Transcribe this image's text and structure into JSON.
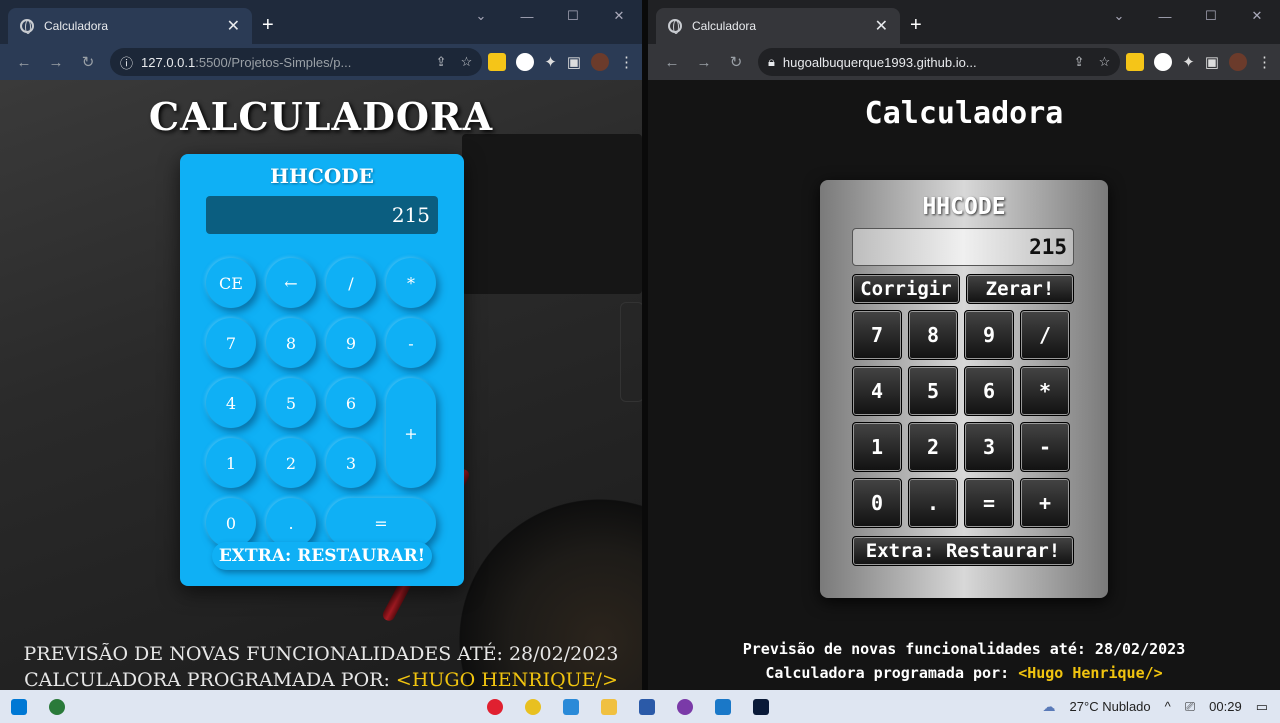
{
  "left_window": {
    "tab_title": "Calculadora",
    "url_host": "127.0.0.1",
    "url_rest": ":5500/Projetos-Simples/p...",
    "page": {
      "title": "CALCULADORA",
      "brand": "HHCODE",
      "display": "215",
      "buttons": [
        "CE",
        "←",
        "/",
        "*",
        "7",
        "8",
        "9",
        "-",
        "4",
        "5",
        "6",
        "+",
        "1",
        "2",
        "3",
        "0",
        ".",
        "="
      ],
      "extra": "EXTRA: RESTAURAR!",
      "footer_line1": "PREVISÃO DE NOVAS FUNCIONALIDADES ATÉ: 28/02/2023",
      "footer_line2_prefix": "CALCULADORA PROGRAMADA POR: ",
      "footer_line2_link": "<HUGO HENRIQUE/>"
    }
  },
  "right_window": {
    "tab_title": "Calculadora",
    "url": "hugoalbuquerque1993.github.io...",
    "page": {
      "title": "Calculadora",
      "brand": "HHCODE",
      "display": "215",
      "btn_corrigir": "Corrigir",
      "btn_zerar": "Zerar!",
      "buttons": [
        "7",
        "8",
        "9",
        "/",
        "4",
        "5",
        "6",
        "*",
        "1",
        "2",
        "3",
        "-",
        "0",
        ".",
        "=",
        "+"
      ],
      "extra": "Extra: Restaurar!",
      "footer_line1": "Previsão de novas funcionalidades até: 28/02/2023",
      "footer_line2_prefix": "Calculadora programada por: ",
      "footer_line2_link": "<Hugo Henrique/>"
    }
  },
  "taskbar": {
    "weather": "27°C  Nublado",
    "time": "00:29"
  },
  "colors": {
    "left_calc": "#0fb0f5",
    "accent_link": "#f1c40f"
  }
}
